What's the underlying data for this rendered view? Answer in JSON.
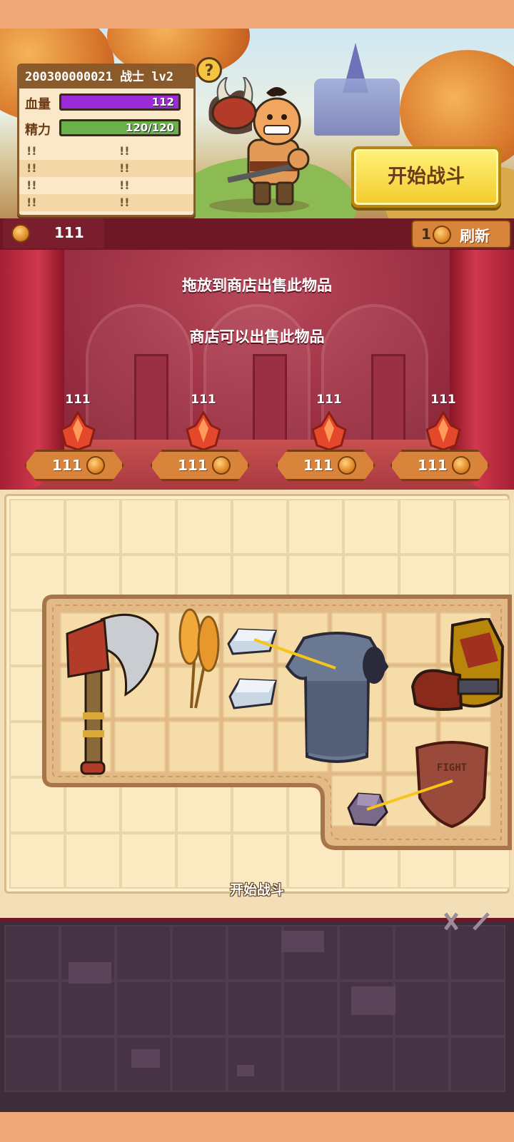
{
  "player": {
    "id_line": "200300000021 战士 lv2",
    "hp_label": "血量",
    "hp_value": "112",
    "hp_fraction": 1.0,
    "energy_label": "精力",
    "energy_value": "120/120",
    "energy_fraction": 1.0,
    "extra_stats": [
      [
        "!!",
        "!!"
      ],
      [
        "!!",
        "!!"
      ],
      [
        "!!",
        "!!"
      ],
      [
        "!!",
        "!!"
      ]
    ],
    "colors": {
      "hp": "#9b2bd6",
      "energy": "#6ab04c"
    }
  },
  "help_icon": "?",
  "start_button_label": "开始战斗",
  "shop": {
    "gold": "111",
    "refresh_count": "1",
    "refresh_label": "刷新",
    "hint_drag": "拖放到商店出售此物品",
    "hint_sell": "商店可以出售此物品",
    "slots": [
      {
        "qty": "111",
        "price": "111",
        "icon": "fire-crystal-icon"
      },
      {
        "qty": "111",
        "price": "111",
        "icon": "fire-crystal-icon"
      },
      {
        "qty": "111",
        "price": "111",
        "icon": "fire-crystal-icon"
      },
      {
        "qty": "111",
        "price": "111",
        "icon": "fire-crystal-icon"
      }
    ]
  },
  "backpack": {
    "items": [
      "battle-axe-icon",
      "wheat-icon",
      "iron-ingot-icon",
      "iron-ingot-icon",
      "chainmail-armor-icon",
      "gauntlet-icon",
      "wooden-shield-icon",
      "ore-stone-icon"
    ],
    "shield_text": "FIGHT",
    "bottom_hint": "开始战斗"
  }
}
